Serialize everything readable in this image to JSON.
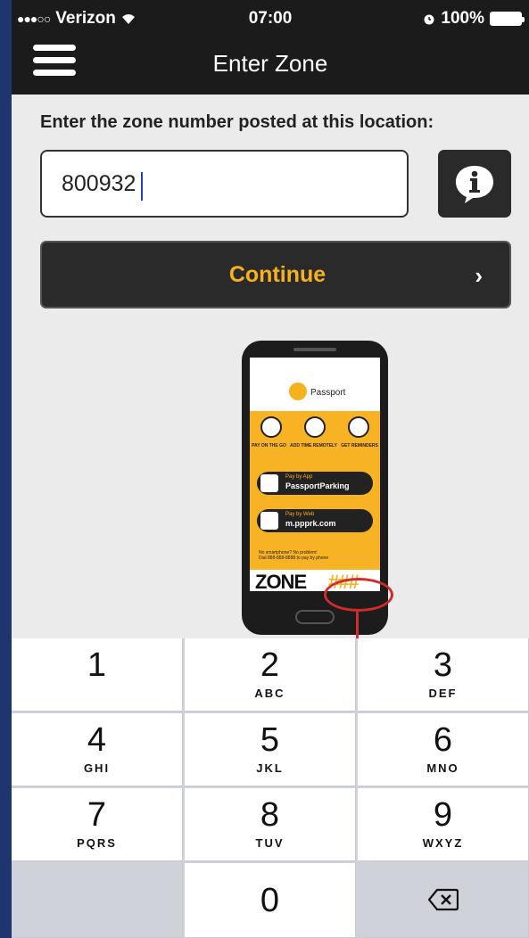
{
  "status_bar": {
    "signal": "●●●○○",
    "carrier": "Verizon",
    "wifi_icon": "wifi-icon",
    "time": "07:00",
    "alarm_icon": "alarm-icon",
    "battery": "100%"
  },
  "nav": {
    "title": "Enter Zone",
    "menu_icon": "hamburger-menu-icon"
  },
  "form": {
    "prompt": "Enter the zone number posted at this location:",
    "zone_value": "800932",
    "info_icon": "info-icon",
    "continue_label": "Continue",
    "continue_chevron": "›"
  },
  "illustration": {
    "brand": "Passport",
    "features": [
      "PAY ON THE GO",
      "ADD TIME REMOTELY",
      "GET REMINDERS"
    ],
    "pay_app_small": "Pay by App",
    "pay_app_big": "PassportParking",
    "pay_web_small": "Pay by Web",
    "pay_web_big": "m.ppprk.com",
    "no_smartphone": "No smartphone? No problem!",
    "dial_text": "Dial 888-888-8888 to pay by phone",
    "zone_word": "ZONE",
    "zone_placeholder": "###",
    "accent_color": "#f6b21d"
  },
  "keypad": {
    "keys": [
      {
        "digit": "1",
        "letters": ""
      },
      {
        "digit": "2",
        "letters": "ABC"
      },
      {
        "digit": "3",
        "letters": "DEF"
      },
      {
        "digit": "4",
        "letters": "GHI"
      },
      {
        "digit": "5",
        "letters": "JKL"
      },
      {
        "digit": "6",
        "letters": "MNO"
      },
      {
        "digit": "7",
        "letters": "PQRS"
      },
      {
        "digit": "8",
        "letters": "TUV"
      },
      {
        "digit": "9",
        "letters": "WXYZ"
      },
      {
        "digit": "0",
        "letters": ""
      }
    ],
    "delete_icon": "backspace-icon"
  }
}
